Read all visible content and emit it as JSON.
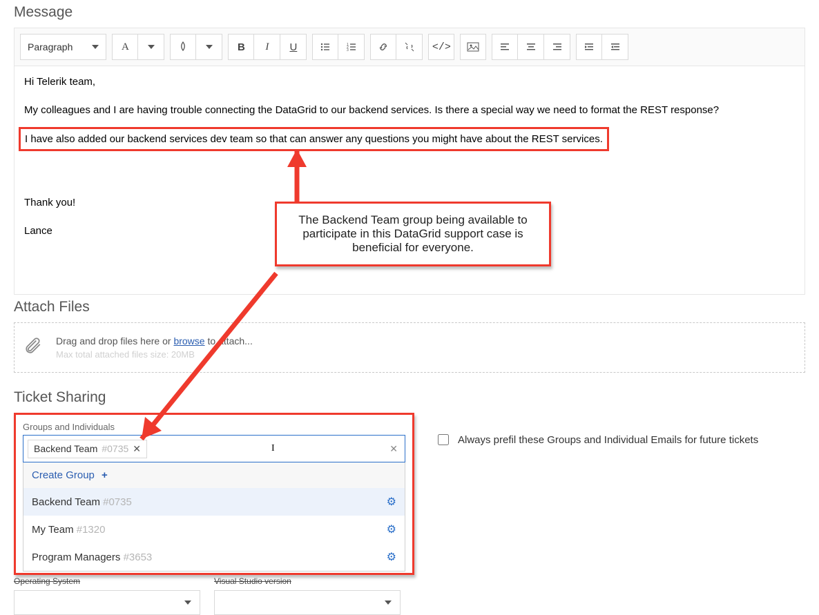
{
  "sections": {
    "message": "Message",
    "attach": "Attach Files",
    "sharing": "Ticket Sharing"
  },
  "toolbar": {
    "format_label": "Paragraph"
  },
  "message": {
    "p1": "Hi Telerik team,",
    "p2": "My colleagues and I are having trouble connecting the DataGrid to our backend services. Is there a special way we need to format the REST response?",
    "p3": "I have also added our backend services dev team so that can answer any questions you might have about the REST services.",
    "p4": "Thank you!",
    "p5": "Lance"
  },
  "callout": {
    "text": "The Backend Team group being available to participate in this DataGrid support case  is beneficial for everyone."
  },
  "attach": {
    "text_pre": "Drag and drop files here or ",
    "browse": "browse",
    "text_post": " to attach...",
    "sub": "Max total attached files size: 20MB"
  },
  "sharing": {
    "label": "Groups and Individuals",
    "tag": {
      "name": "Backend Team",
      "id": "#0735"
    },
    "dropdown": {
      "create": "Create Group",
      "items": [
        {
          "name": "Backend Team",
          "id": "#0735",
          "selected": true
        },
        {
          "name": "My Team",
          "id": "#1320",
          "selected": false
        },
        {
          "name": "Program Managers",
          "id": "#3653",
          "selected": false
        }
      ]
    },
    "prefill": "Always prefil these Groups and Individual Emails for future tickets"
  },
  "under": {
    "os": "Operating System",
    "vs": "Visual Studio version"
  }
}
